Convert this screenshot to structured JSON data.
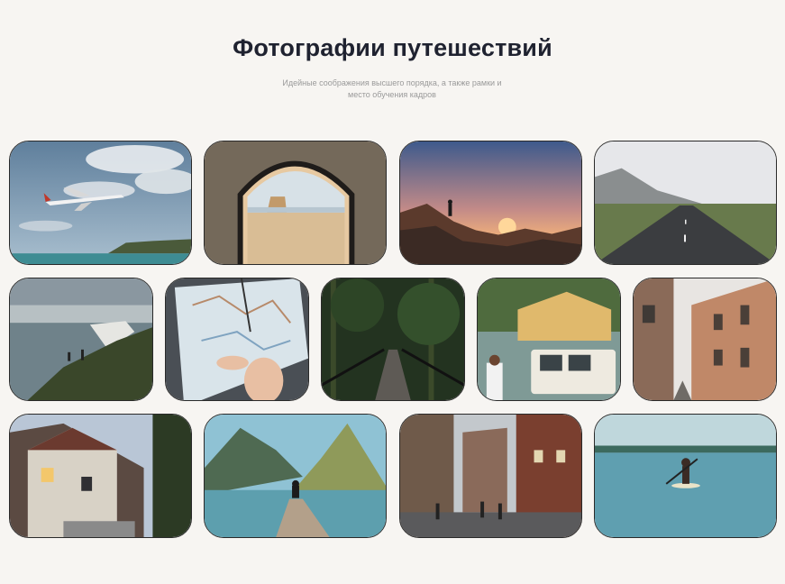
{
  "header": {
    "title": "Фотографии путешествий",
    "subtitle": "Идейные соображения высшего порядка, а также рамки и место обучения кадров"
  },
  "gallery": {
    "rows": [
      {
        "photos": [
          {
            "name": "photo-airplane-over-sea",
            "scene": "Пассажирский самолёт в облачном небе над морем"
          },
          {
            "name": "photo-tent-desert-view",
            "scene": "Вид на пустыню из палатки"
          },
          {
            "name": "photo-hiker-sunset",
            "scene": "Путешественник на скалах на закате"
          },
          {
            "name": "photo-empty-road",
            "scene": "Пустая дорога среди полей в тумане"
          }
        ]
      },
      {
        "photos": [
          {
            "name": "photo-white-cliffs",
            "scene": "Двое людей у белых скал над морем"
          },
          {
            "name": "photo-map-in-car",
            "scene": "Карта в руках в автомобиле"
          },
          {
            "name": "photo-forest-bridge",
            "scene": "Мост в тропическом лесу"
          },
          {
            "name": "photo-roof-tent-car",
            "scene": "Палатка на крыше автомобиля у озера"
          },
          {
            "name": "photo-old-street",
            "scene": "Старинная улица между домами"
          }
        ]
      },
      {
        "photos": [
          {
            "name": "photo-village-lane",
            "scene": "Деревенская улочка с фонарями"
          },
          {
            "name": "photo-fjord-pier",
            "scene": "Человек на пирсе у фьорда"
          },
          {
            "name": "photo-city-street",
            "scene": "Оживлённая городская улица"
          },
          {
            "name": "photo-paddle-board",
            "scene": "Девушка на сапборде в озере"
          }
        ]
      }
    ]
  }
}
